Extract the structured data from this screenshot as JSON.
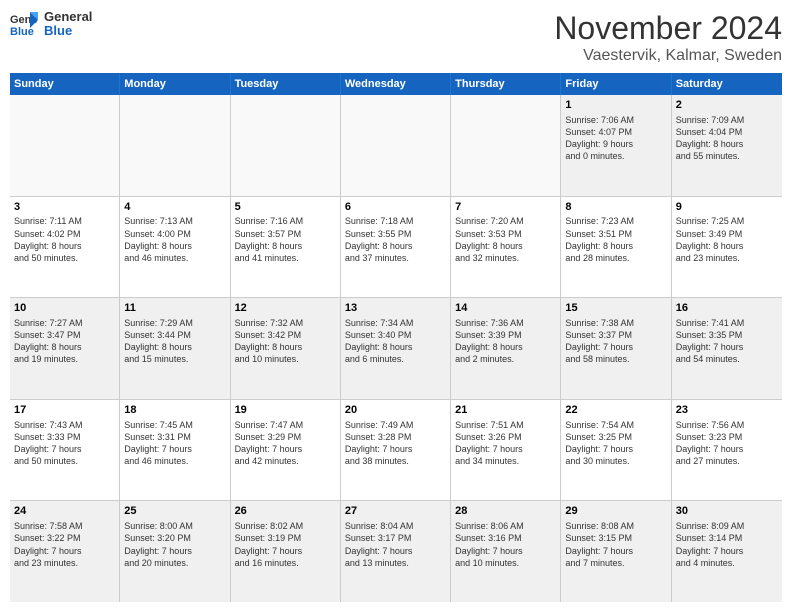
{
  "logo": {
    "general": "General",
    "blue": "Blue"
  },
  "header": {
    "title": "November 2024",
    "subtitle": "Vaestervik, Kalmar, Sweden"
  },
  "weekdays": [
    "Sunday",
    "Monday",
    "Tuesday",
    "Wednesday",
    "Thursday",
    "Friday",
    "Saturday"
  ],
  "weeks": [
    [
      {
        "day": "",
        "info": ""
      },
      {
        "day": "",
        "info": ""
      },
      {
        "day": "",
        "info": ""
      },
      {
        "day": "",
        "info": ""
      },
      {
        "day": "",
        "info": ""
      },
      {
        "day": "1",
        "info": "Sunrise: 7:06 AM\nSunset: 4:07 PM\nDaylight: 9 hours\nand 0 minutes."
      },
      {
        "day": "2",
        "info": "Sunrise: 7:09 AM\nSunset: 4:04 PM\nDaylight: 8 hours\nand 55 minutes."
      }
    ],
    [
      {
        "day": "3",
        "info": "Sunrise: 7:11 AM\nSunset: 4:02 PM\nDaylight: 8 hours\nand 50 minutes."
      },
      {
        "day": "4",
        "info": "Sunrise: 7:13 AM\nSunset: 4:00 PM\nDaylight: 8 hours\nand 46 minutes."
      },
      {
        "day": "5",
        "info": "Sunrise: 7:16 AM\nSunset: 3:57 PM\nDaylight: 8 hours\nand 41 minutes."
      },
      {
        "day": "6",
        "info": "Sunrise: 7:18 AM\nSunset: 3:55 PM\nDaylight: 8 hours\nand 37 minutes."
      },
      {
        "day": "7",
        "info": "Sunrise: 7:20 AM\nSunset: 3:53 PM\nDaylight: 8 hours\nand 32 minutes."
      },
      {
        "day": "8",
        "info": "Sunrise: 7:23 AM\nSunset: 3:51 PM\nDaylight: 8 hours\nand 28 minutes."
      },
      {
        "day": "9",
        "info": "Sunrise: 7:25 AM\nSunset: 3:49 PM\nDaylight: 8 hours\nand 23 minutes."
      }
    ],
    [
      {
        "day": "10",
        "info": "Sunrise: 7:27 AM\nSunset: 3:47 PM\nDaylight: 8 hours\nand 19 minutes."
      },
      {
        "day": "11",
        "info": "Sunrise: 7:29 AM\nSunset: 3:44 PM\nDaylight: 8 hours\nand 15 minutes."
      },
      {
        "day": "12",
        "info": "Sunrise: 7:32 AM\nSunset: 3:42 PM\nDaylight: 8 hours\nand 10 minutes."
      },
      {
        "day": "13",
        "info": "Sunrise: 7:34 AM\nSunset: 3:40 PM\nDaylight: 8 hours\nand 6 minutes."
      },
      {
        "day": "14",
        "info": "Sunrise: 7:36 AM\nSunset: 3:39 PM\nDaylight: 8 hours\nand 2 minutes."
      },
      {
        "day": "15",
        "info": "Sunrise: 7:38 AM\nSunset: 3:37 PM\nDaylight: 7 hours\nand 58 minutes."
      },
      {
        "day": "16",
        "info": "Sunrise: 7:41 AM\nSunset: 3:35 PM\nDaylight: 7 hours\nand 54 minutes."
      }
    ],
    [
      {
        "day": "17",
        "info": "Sunrise: 7:43 AM\nSunset: 3:33 PM\nDaylight: 7 hours\nand 50 minutes."
      },
      {
        "day": "18",
        "info": "Sunrise: 7:45 AM\nSunset: 3:31 PM\nDaylight: 7 hours\nand 46 minutes."
      },
      {
        "day": "19",
        "info": "Sunrise: 7:47 AM\nSunset: 3:29 PM\nDaylight: 7 hours\nand 42 minutes."
      },
      {
        "day": "20",
        "info": "Sunrise: 7:49 AM\nSunset: 3:28 PM\nDaylight: 7 hours\nand 38 minutes."
      },
      {
        "day": "21",
        "info": "Sunrise: 7:51 AM\nSunset: 3:26 PM\nDaylight: 7 hours\nand 34 minutes."
      },
      {
        "day": "22",
        "info": "Sunrise: 7:54 AM\nSunset: 3:25 PM\nDaylight: 7 hours\nand 30 minutes."
      },
      {
        "day": "23",
        "info": "Sunrise: 7:56 AM\nSunset: 3:23 PM\nDaylight: 7 hours\nand 27 minutes."
      }
    ],
    [
      {
        "day": "24",
        "info": "Sunrise: 7:58 AM\nSunset: 3:22 PM\nDaylight: 7 hours\nand 23 minutes."
      },
      {
        "day": "25",
        "info": "Sunrise: 8:00 AM\nSunset: 3:20 PM\nDaylight: 7 hours\nand 20 minutes."
      },
      {
        "day": "26",
        "info": "Sunrise: 8:02 AM\nSunset: 3:19 PM\nDaylight: 7 hours\nand 16 minutes."
      },
      {
        "day": "27",
        "info": "Sunrise: 8:04 AM\nSunset: 3:17 PM\nDaylight: 7 hours\nand 13 minutes."
      },
      {
        "day": "28",
        "info": "Sunrise: 8:06 AM\nSunset: 3:16 PM\nDaylight: 7 hours\nand 10 minutes."
      },
      {
        "day": "29",
        "info": "Sunrise: 8:08 AM\nSunset: 3:15 PM\nDaylight: 7 hours\nand 7 minutes."
      },
      {
        "day": "30",
        "info": "Sunrise: 8:09 AM\nSunset: 3:14 PM\nDaylight: 7 hours\nand 4 minutes."
      }
    ]
  ]
}
